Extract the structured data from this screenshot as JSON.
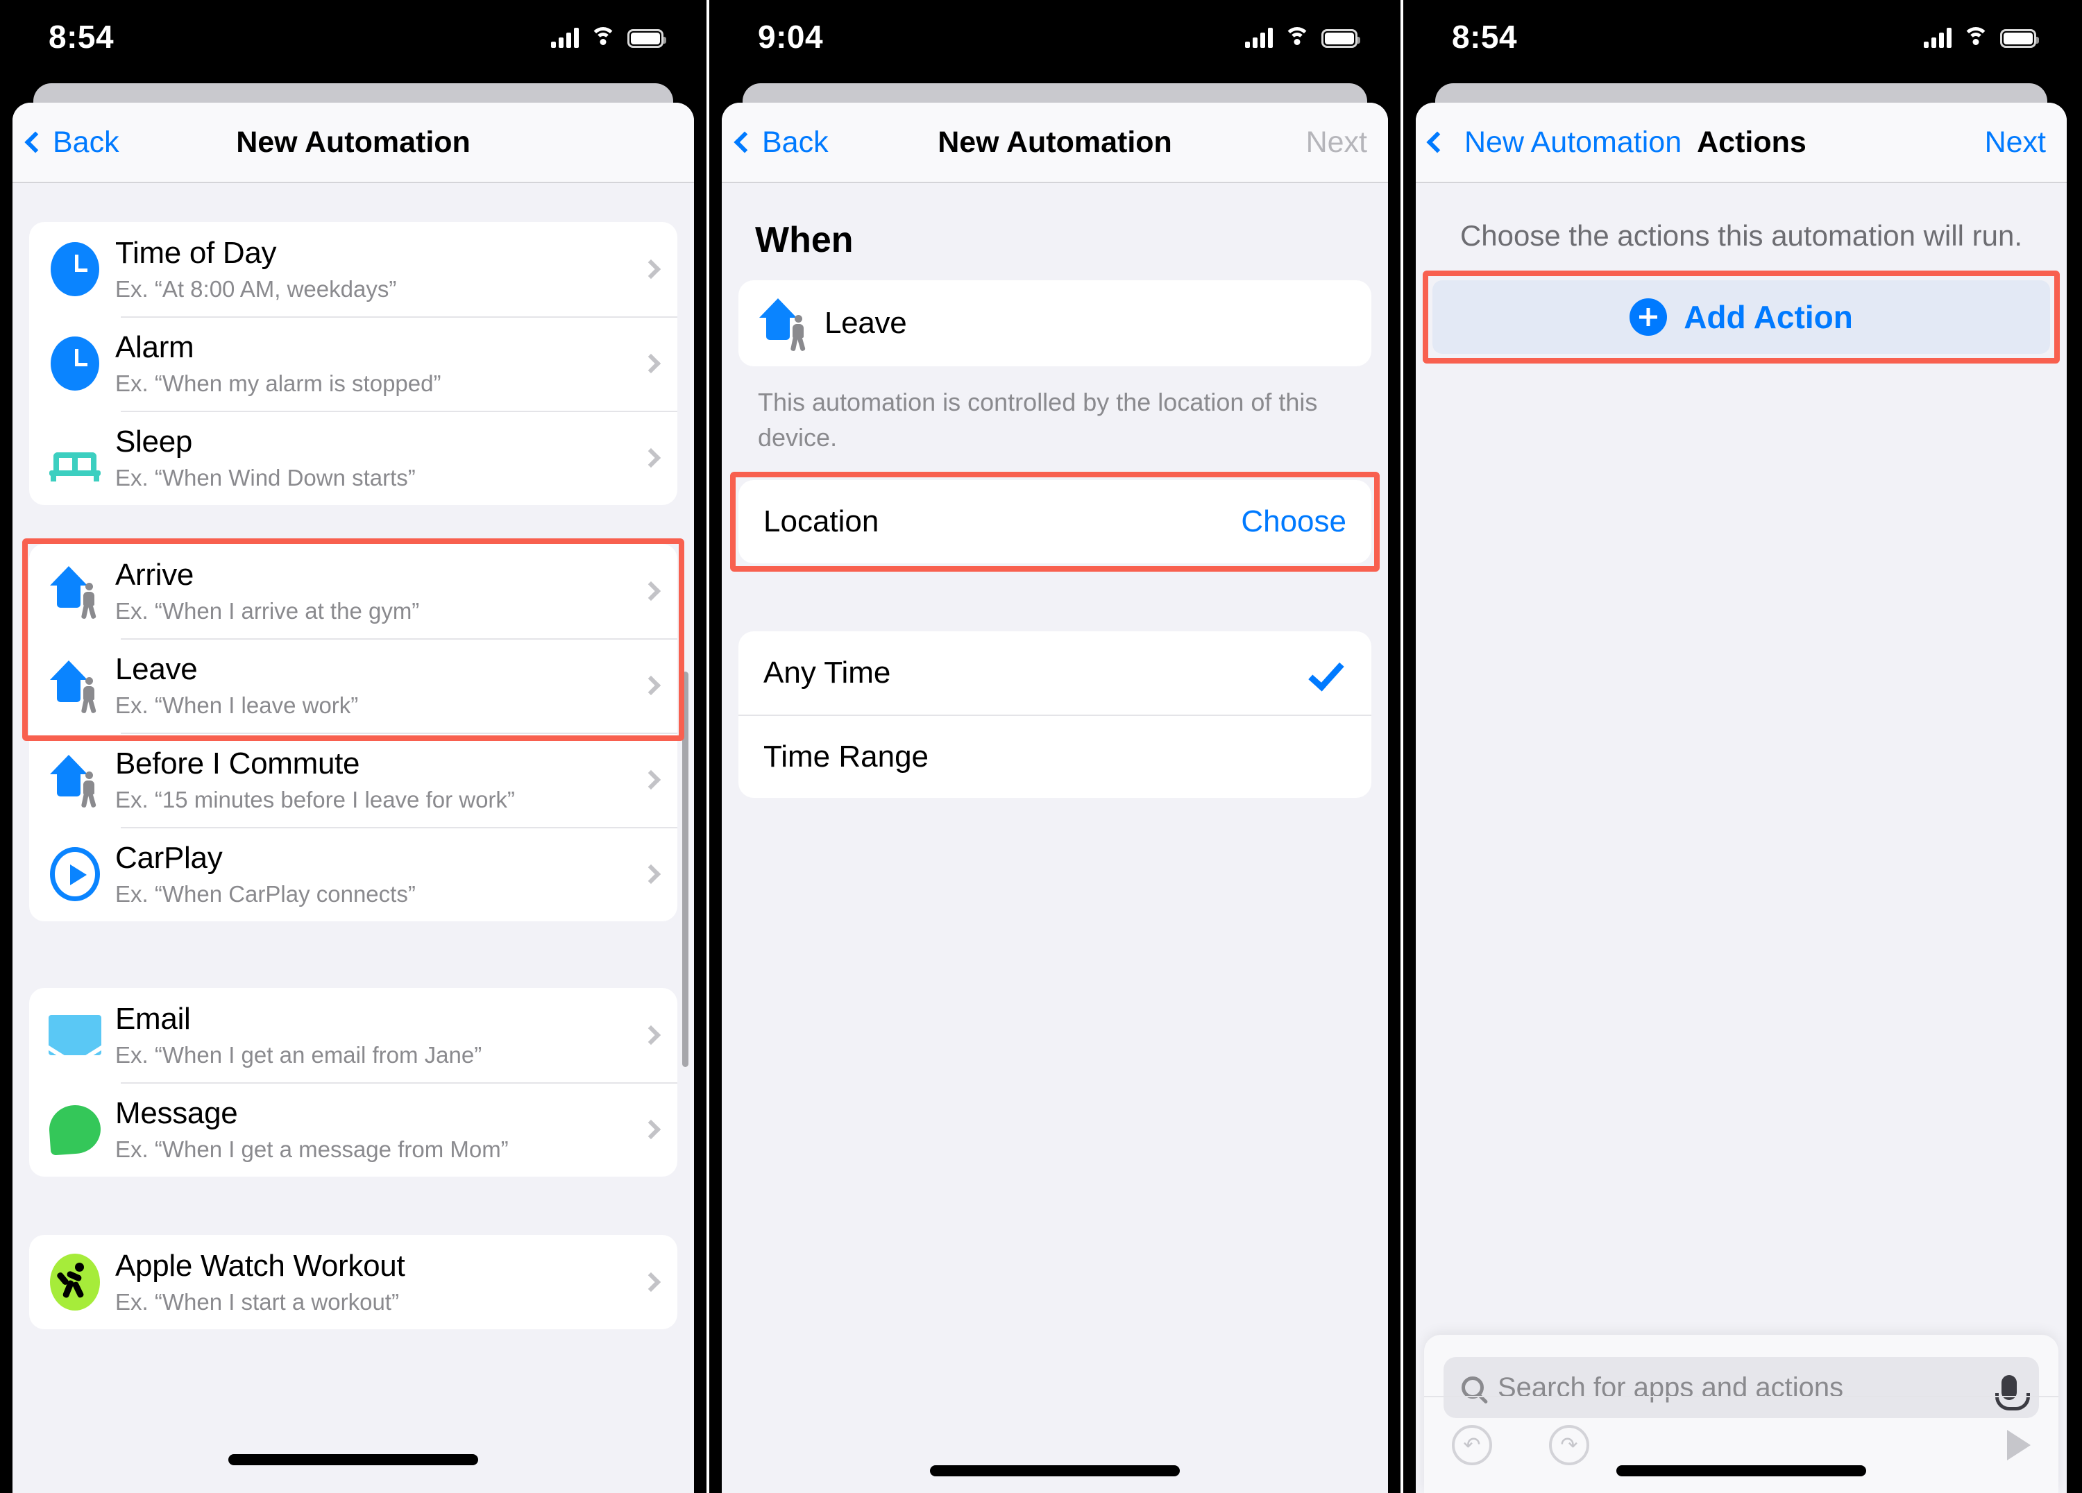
{
  "panel1": {
    "statusbar": {
      "time": "8:54"
    },
    "nav": {
      "back": "Back",
      "title": "New Automation"
    },
    "groups": [
      {
        "items": [
          {
            "icon": "clock-icon",
            "title": "Time of Day",
            "subtitle": "Ex. “At 8:00 AM, weekdays”"
          },
          {
            "icon": "alarm-clock-icon",
            "title": "Alarm",
            "subtitle": "Ex. “When my alarm is stopped”"
          },
          {
            "icon": "bed-icon",
            "title": "Sleep",
            "subtitle": "Ex. “When Wind Down starts”"
          }
        ]
      },
      {
        "highlighted": true,
        "items": [
          {
            "icon": "house-walking-icon",
            "title": "Arrive",
            "subtitle": "Ex. “When I arrive at the gym”"
          },
          {
            "icon": "house-walking-icon",
            "title": "Leave",
            "subtitle": "Ex. “When I leave work”"
          },
          {
            "icon": "house-walking-icon",
            "title": "Before I Commute",
            "subtitle": "Ex. “15 minutes before I leave for work”"
          },
          {
            "icon": "carplay-icon",
            "title": "CarPlay",
            "subtitle": "Ex. “When CarPlay connects”"
          }
        ]
      },
      {
        "items": [
          {
            "icon": "mail-icon",
            "title": "Email",
            "subtitle": "Ex. “When I get an email from Jane”"
          },
          {
            "icon": "message-bubble-icon",
            "title": "Message",
            "subtitle": "Ex. “When I get a message from Mom”"
          }
        ]
      },
      {
        "items": [
          {
            "icon": "running-person-icon",
            "title": "Apple Watch Workout",
            "subtitle": "Ex. “When I start a workout”"
          }
        ]
      }
    ]
  },
  "panel2": {
    "statusbar": {
      "time": "9:04"
    },
    "nav": {
      "back": "Back",
      "title": "New Automation",
      "next": "Next"
    },
    "section_title": "When",
    "trigger": {
      "icon": "house-walking-icon",
      "label": "Leave"
    },
    "footnote": "This automation is controlled by the location of this device.",
    "location_row": {
      "label": "Location",
      "value": "Choose"
    },
    "time_options": [
      {
        "label": "Any Time",
        "selected": true
      },
      {
        "label": "Time Range",
        "selected": false
      }
    ]
  },
  "panel3": {
    "statusbar": {
      "time": "8:54"
    },
    "nav": {
      "back": "New Automation",
      "title": "Actions",
      "next": "Next"
    },
    "hint": "Choose the actions this automation will run.",
    "add_action": {
      "label": "Add Action",
      "icon": "plus-circle-icon"
    },
    "search": {
      "placeholder": "Search for apps and actions",
      "icon": "search-icon",
      "mic": "microphone-icon"
    },
    "toolbar": {
      "undo": "undo-icon",
      "redo": "redo-icon",
      "run": "play-icon"
    }
  },
  "colors": {
    "accent": "#007aff",
    "highlight": "#f8604f",
    "blue_icon": "#0a84ff",
    "green": "#34c759",
    "teal": "#3ccfc0",
    "lime": "#a6ec3a",
    "sky": "#5ac8f5"
  }
}
